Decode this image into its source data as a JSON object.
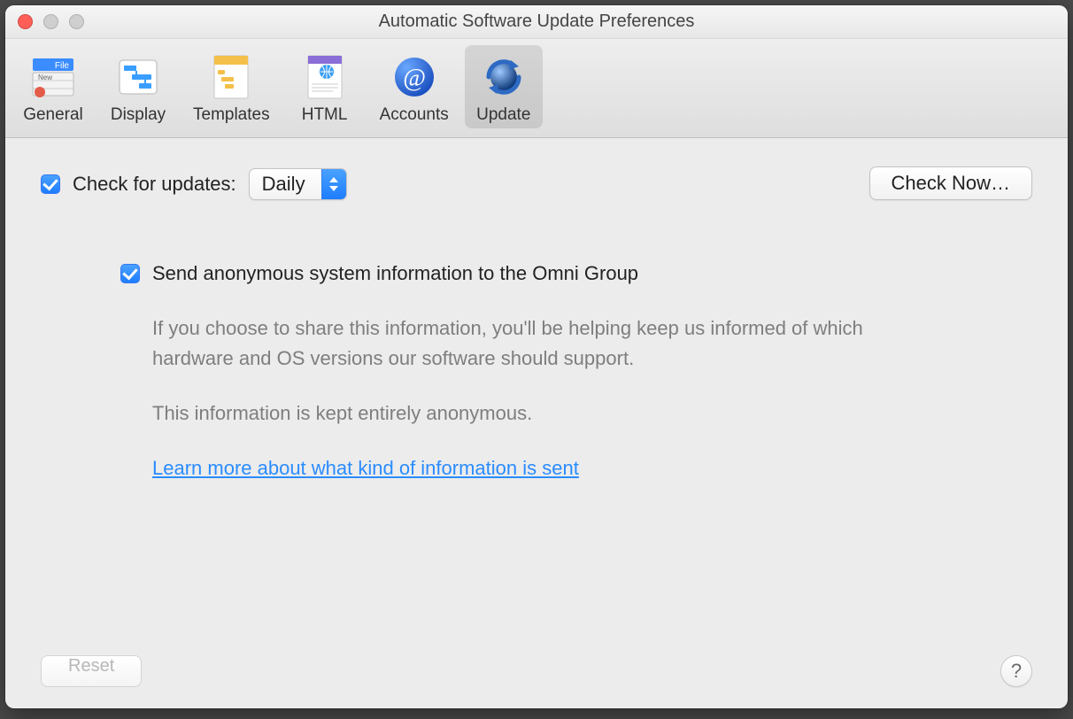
{
  "window": {
    "title": "Automatic Software Update Preferences"
  },
  "toolbar": {
    "general": "General",
    "display": "Display",
    "templates": "Templates",
    "html": "HTML",
    "accounts": "Accounts",
    "update": "Update",
    "selected": "update"
  },
  "update": {
    "check_label": "Check for updates:",
    "frequency": "Daily",
    "check_now_label": "Check Now…",
    "send_anon_label": "Send anonymous system information to the Omni Group",
    "desc1": "If you choose to share this information, you'll be helping keep us informed of which hardware and OS versions our software should support.",
    "desc2": "This information is kept entirely anonymous.",
    "learn_more": "Learn more about what kind of information is sent"
  },
  "footer": {
    "reset": "Reset",
    "help": "?"
  }
}
